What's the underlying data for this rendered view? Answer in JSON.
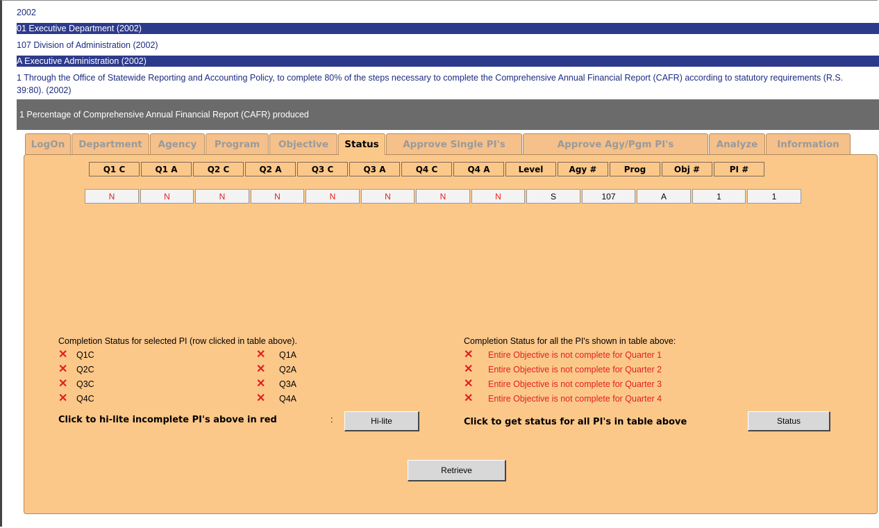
{
  "headers": {
    "year": "2002",
    "department": "01   Executive Department (2002)",
    "agency": "107   Division of Administration (2002)",
    "program": "A   Executive Administration (2002)",
    "objective": "1   Through the Office of Statewide Reporting and Accounting Policy, to complete 80% of the steps necessary to complete the Comprehensive Annual Financial Report (CAFR) according to statutory requirements (R.S. 39:80). (2002)",
    "indicator": "1  Percentage of Comprehensive Annual Financial Report (CAFR) produced"
  },
  "tabs": [
    "LogOn",
    "Department",
    "Agency",
    "Program",
    "Objective",
    "Status",
    "Approve Single PI's",
    "Approve Agy/Pgm PI's",
    "Analyze",
    "Information"
  ],
  "active_tab": "Status",
  "table": {
    "columns": [
      "Q1 C",
      "Q1 A",
      "Q2 C",
      "Q2 A",
      "Q3 C",
      "Q3 A",
      "Q4 C",
      "Q4 A",
      "Level",
      "Agy #",
      "Prog",
      "Obj #",
      "PI #"
    ],
    "row": [
      "N",
      "N",
      "N",
      "N",
      "N",
      "N",
      "N",
      "N",
      "S",
      "107",
      "A",
      "1",
      "1"
    ]
  },
  "selected_status": {
    "title": "Completion Status for selected PI (row clicked in table above).",
    "left": [
      "Q1C",
      "Q2C",
      "Q3C",
      "Q4C"
    ],
    "right": [
      "Q1A",
      "Q2A",
      "Q3A",
      "Q4A"
    ],
    "hilite_label": "Click to hi-lite incomplete PI's above in red",
    "hilite_sep": ":",
    "hilite_button": "Hi-lite"
  },
  "all_status": {
    "title": "Completion Status for all the PI's shown in table above:",
    "items": [
      "Entire Objective is not complete for Quarter 1",
      "Entire Objective is not complete for Quarter 2",
      "Entire Objective is not complete for Quarter 3",
      "Entire Objective is not complete for Quarter 4"
    ],
    "status_label": "Click to get status for all PI's in table above",
    "status_button": "Status"
  },
  "retrieve_button": "Retrieve",
  "icons": {
    "incomplete": "x-mark-icon"
  },
  "colors": {
    "accent": "#2d3a8c",
    "panel": "#fcc88a",
    "incomplete": "#e02020"
  }
}
